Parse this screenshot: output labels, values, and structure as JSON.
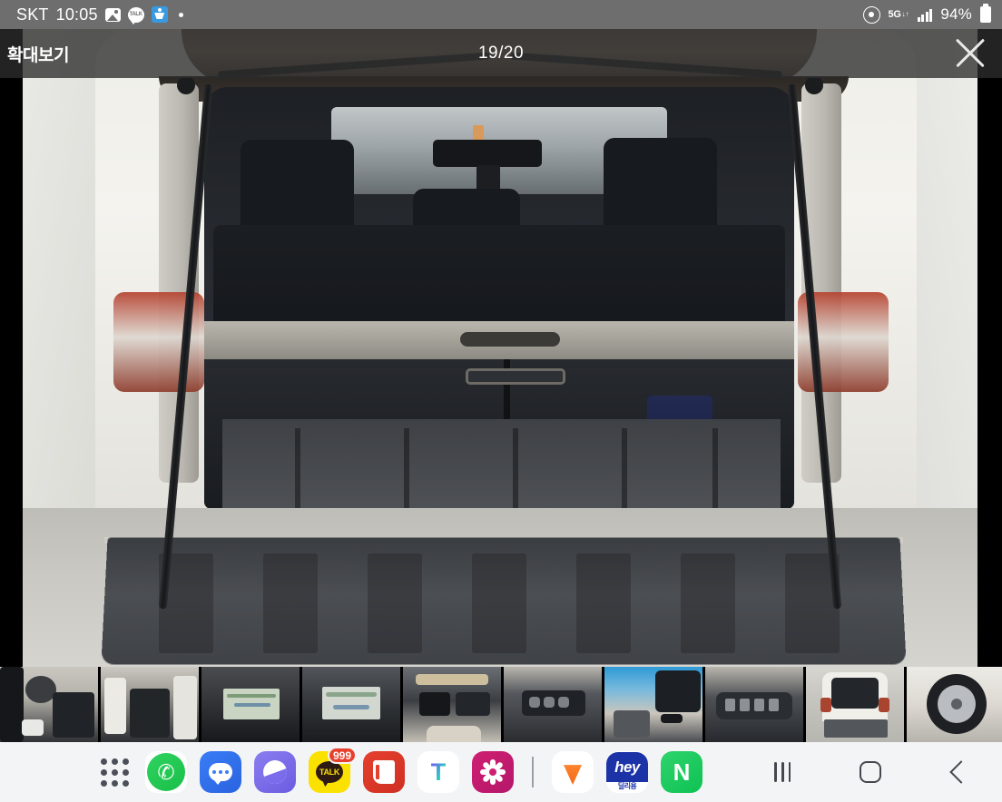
{
  "status_bar": {
    "carrier": "SKT",
    "time": "10:05",
    "notification_icons": [
      "gallery-icon",
      "kakaotalk-icon",
      "blue-app-icon",
      "more-dot-icon"
    ],
    "network_label": "5G",
    "battery_percent": "94%",
    "right_icons": [
      "hotspot-icon",
      "5g-icon",
      "signal-bars-icon",
      "battery-icon"
    ]
  },
  "viewer": {
    "title": "확대보기",
    "counter": "19/20",
    "close_label": "✕",
    "overlay_color": "#2d2d2d",
    "photo_description": "SUV 트렁크 내부 (테일게이트 개방)"
  },
  "thumbnails": {
    "selected_index": 8,
    "selected_border_color": "#d4573f",
    "items": [
      {
        "label": "운전석 실내"
      },
      {
        "label": "뒷좌석 실내"
      },
      {
        "label": "내비게이션 화면"
      },
      {
        "label": "센터 디스플레이"
      },
      {
        "label": "선루프"
      },
      {
        "label": "도어 스위치"
      },
      {
        "label": "룸미러 / 블랙박스"
      },
      {
        "label": "도어 트림 스위치"
      },
      {
        "label": "트렁크 적재함"
      },
      {
        "label": "휠 / 타이어"
      }
    ]
  },
  "dock": {
    "background": "#f3f4f6",
    "apps": [
      {
        "name": "apps-grid",
        "label": "앱스"
      },
      {
        "name": "phone",
        "label": "전화"
      },
      {
        "name": "messages",
        "label": "메시지"
      },
      {
        "name": "samsung-internet",
        "label": "인터넷"
      },
      {
        "name": "kakaotalk",
        "label": "TALK",
        "badge": "999"
      },
      {
        "name": "note",
        "label": "메모"
      },
      {
        "name": "tmap",
        "label": "T"
      },
      {
        "name": "cake-flower",
        "label": "꽃"
      },
      {
        "name": "karrot",
        "label": "당근"
      },
      {
        "name": "hey",
        "label": "hey",
        "sub_label": "딜리용"
      },
      {
        "name": "naver",
        "label": "N"
      }
    ]
  },
  "navigation_bar": {
    "recents_label": "최근 앱",
    "home_label": "홈",
    "back_label": "뒤로"
  }
}
